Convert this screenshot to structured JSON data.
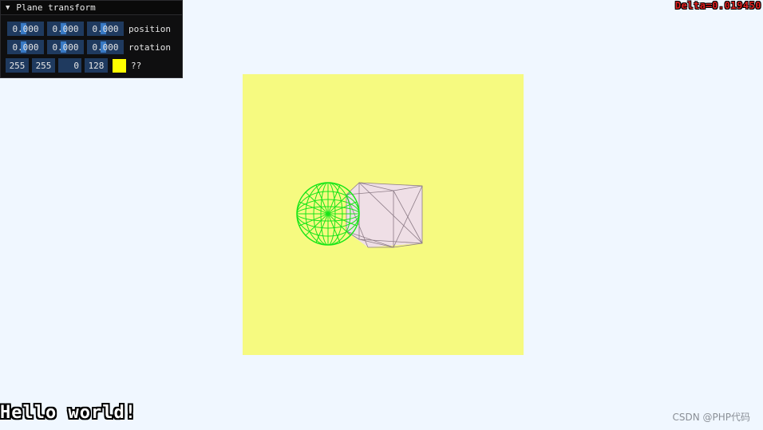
{
  "panel": {
    "title": "Plane transform",
    "collapse_glyph": "▼",
    "position": {
      "x": "0.000",
      "y": "0.000",
      "z": "0.000",
      "label": "position"
    },
    "rotation": {
      "x": "0.000",
      "y": "0.000",
      "z": "0.000",
      "label": "rotation"
    },
    "color": {
      "r": "255",
      "g": "255",
      "b": "0",
      "a": "128",
      "swatch": "#ffff00",
      "label": "??"
    }
  },
  "hud": {
    "delta": "Delta=0.019450",
    "hello": "Hello world!"
  },
  "watermark": "CSDN @PHP代码",
  "scene": {
    "background": "#f0f7ff",
    "plane_color": "#f6fa80",
    "sphere_color": "#19e619",
    "cube_fill": "#efdfe6",
    "cube_edge": "#8c7b86",
    "objects": [
      "plane",
      "wireframe-sphere",
      "wireframe-cube"
    ]
  }
}
